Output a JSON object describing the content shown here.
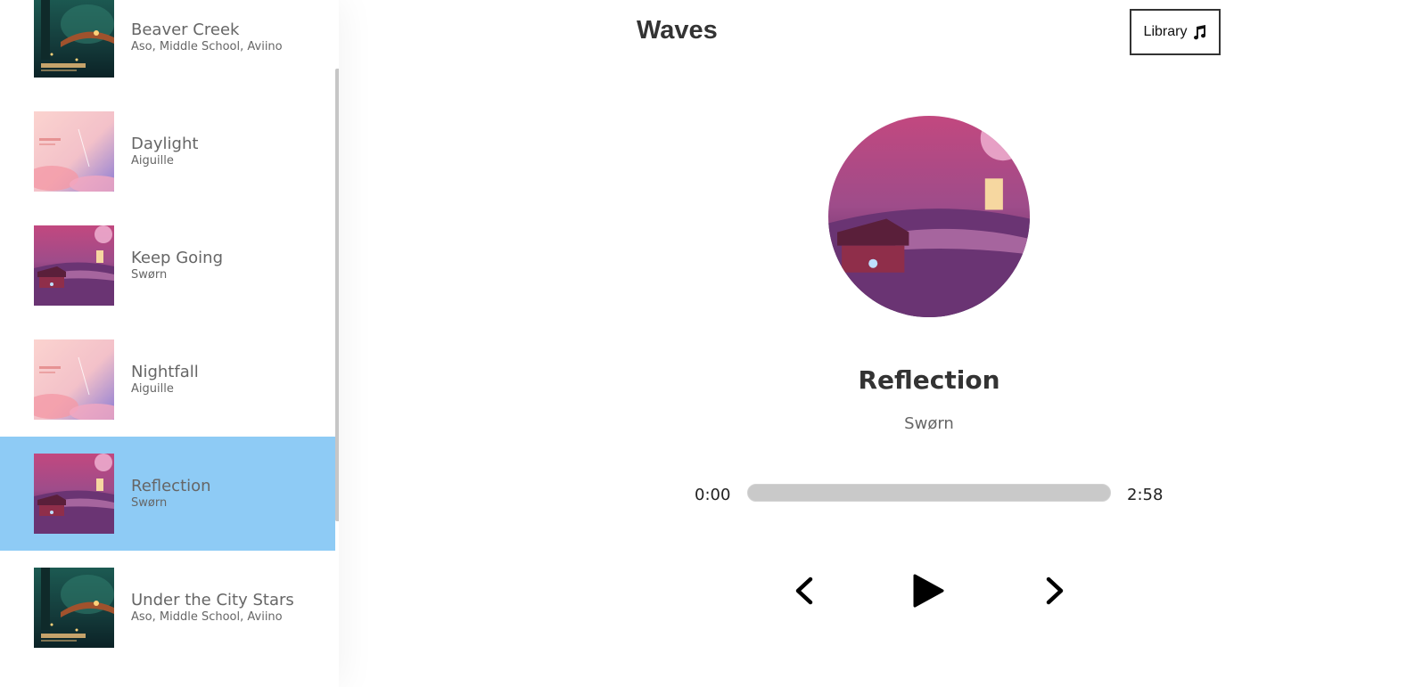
{
  "app": {
    "logo": "Waves",
    "library_button_label": "Library",
    "library_button_icon": "music-note-icon"
  },
  "library": {
    "songs": [
      {
        "name": "Beaver Creek",
        "artist": "Aso, Middle School, Aviino",
        "cover": "canary-forest",
        "selected": false
      },
      {
        "name": "Daylight",
        "artist": "Aiguille",
        "cover": "pink-pastel",
        "selected": false
      },
      {
        "name": "Keep Going",
        "artist": "Swørn",
        "cover": "purple-lantern",
        "selected": false
      },
      {
        "name": "Nightfall",
        "artist": "Aiguille",
        "cover": "pink-pastel",
        "selected": false
      },
      {
        "name": "Reflection",
        "artist": "Swørn",
        "cover": "purple-lantern",
        "selected": true
      },
      {
        "name": "Under the City Stars",
        "artist": "Aso, Middle School, Aviino",
        "cover": "canary-forest",
        "selected": false
      }
    ]
  },
  "now_playing": {
    "title": "Reflection",
    "artist": "Swørn",
    "current_time": "0:00",
    "duration": "2:58",
    "progress": 0
  },
  "controls": {
    "prev_icon": "chevron-left-icon",
    "play_icon": "play-icon",
    "next_icon": "chevron-right-icon"
  },
  "colors": {
    "selected": "#8ecbf5",
    "track": "#c9c9c9",
    "text": "#333333"
  }
}
